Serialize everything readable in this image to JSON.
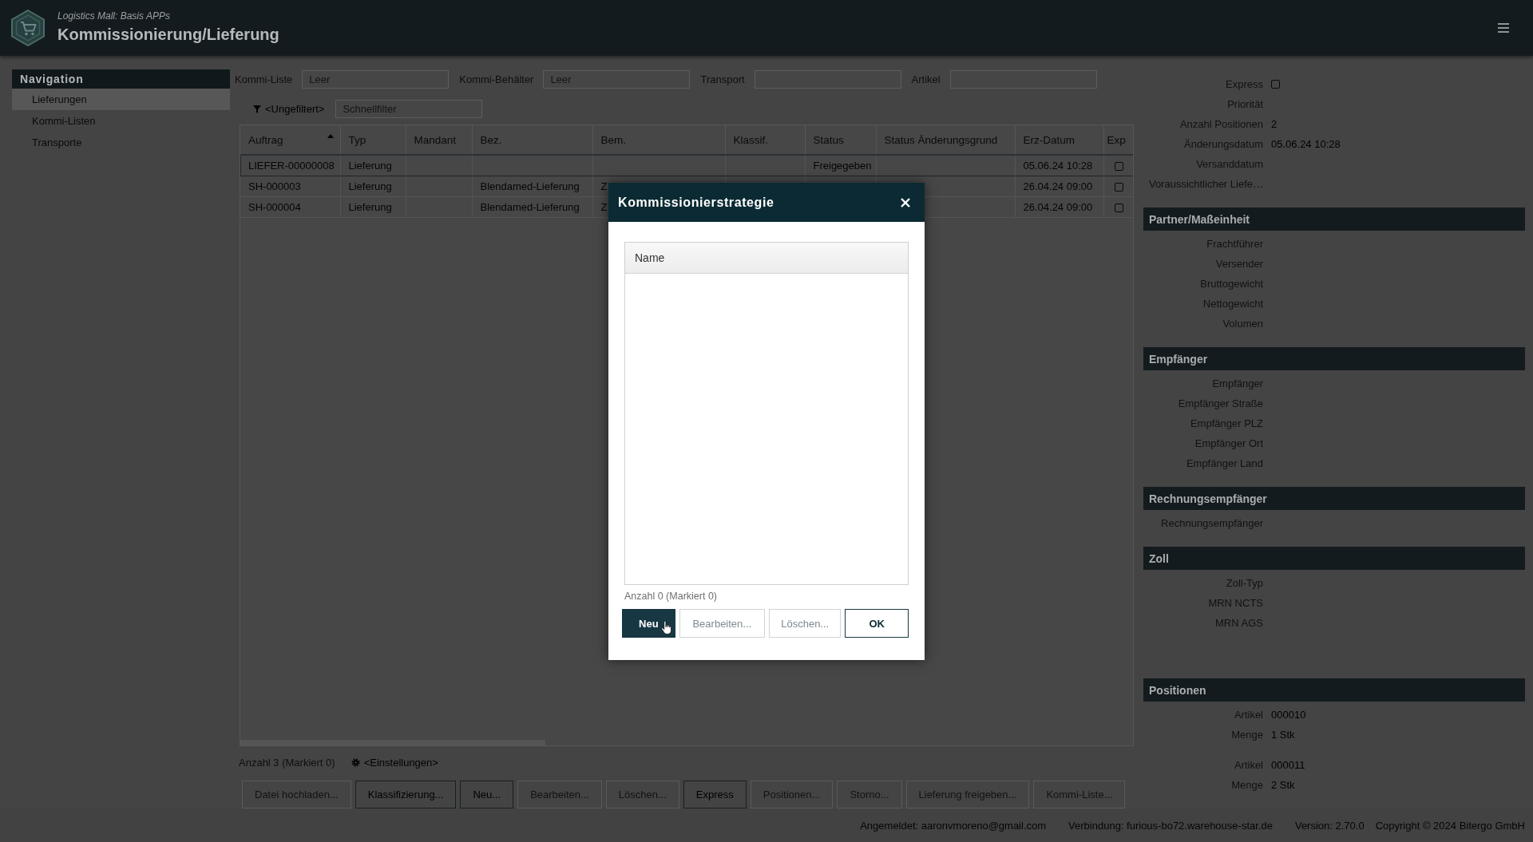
{
  "header": {
    "subtitle": "Logistics Mall: Basis APPs",
    "title": "Kommissionierung/Lieferung"
  },
  "navigation": {
    "title": "Navigation",
    "items": [
      {
        "label": "Lieferungen",
        "selected": true
      },
      {
        "label": "Kommi-Listen",
        "selected": false
      },
      {
        "label": "Transporte",
        "selected": false
      }
    ]
  },
  "filters": [
    {
      "label": "Kommi-Liste",
      "placeholder": "Leer"
    },
    {
      "label": "Kommi-Behälter",
      "placeholder": "Leer"
    },
    {
      "label": "Transport"
    },
    {
      "label": "Artikel"
    }
  ],
  "quick_filter": {
    "filter": "<Ungefiltert>",
    "placeholder": "Schnellfilter"
  },
  "table": {
    "columns": [
      {
        "label": "Auftrag",
        "kind": "text",
        "sorted": true
      },
      {
        "label": "Typ",
        "kind": "text",
        "sorted": false
      },
      {
        "label": "Mandant",
        "kind": "text",
        "sorted": false
      },
      {
        "label": "Bez.",
        "kind": "text",
        "sorted": false
      },
      {
        "label": "Bem.",
        "kind": "text",
        "sorted": false
      },
      {
        "label": "Klassif.",
        "kind": "text",
        "sorted": false
      },
      {
        "label": "Status",
        "kind": "text",
        "sorted": false
      },
      {
        "label": "Status Änderungsgrund",
        "kind": "text",
        "sorted": false
      },
      {
        "label": "Erz-Datum",
        "kind": "text",
        "sorted": false
      },
      {
        "label": "Exp",
        "kind": "checkbox",
        "sorted": false
      }
    ],
    "rows": [
      {
        "selected": true,
        "auftrag": "LIEFER-00000008",
        "typ": "Lieferung",
        "status": "Freigegeben",
        "erz_datum": "05.06.24 10:28",
        "exp": false
      },
      {
        "selected": false,
        "auftrag": "SH-000003",
        "typ": "Lieferung",
        "bez": "Blendamed-Lieferung",
        "bem": "Z",
        "erz_datum": "26.04.24 09:00",
        "exp": false
      },
      {
        "selected": false,
        "auftrag": "SH-000004",
        "typ": "Lieferung",
        "bez": "Blendamed-Lieferung",
        "bem": "Z",
        "erz_datum": "26.04.24 09:00",
        "exp": false
      }
    ]
  },
  "table_footer": {
    "count": "Anzahl 3 (Markiert 0)",
    "settings": "<Einstellungen>"
  },
  "actions": [
    {
      "label": "Datei hochladen...",
      "disabled": true
    },
    {
      "label": "Klassifizierung...",
      "disabled": false
    },
    {
      "label": "Neu...",
      "disabled": false
    },
    {
      "label": "Bearbeiten...",
      "disabled": true
    },
    {
      "label": "Löschen...",
      "disabled": true
    },
    {
      "label": "Express",
      "disabled": false
    },
    {
      "label": "Positionen...",
      "disabled": true
    },
    {
      "label": "Storno...",
      "disabled": true
    },
    {
      "label": "Lieferung freigeben...",
      "disabled": true
    },
    {
      "label": "Kommi-Liste...",
      "disabled": true
    }
  ],
  "details": {
    "fields": [
      {
        "label": "Express",
        "kind": "checkbox",
        "checked": false
      },
      {
        "label": "Priorität",
        "kind": "text"
      },
      {
        "label": "Anzahl Positionen",
        "kind": "text",
        "value": "2"
      },
      {
        "label": "Änderungsdatum",
        "kind": "text",
        "value": "05.06.24 10:28"
      },
      {
        "label": "Versanddatum",
        "kind": "text"
      },
      {
        "label": "Voraussichtlicher Liefe…",
        "kind": "text"
      }
    ],
    "sections": [
      {
        "title": "Partner/Maßeinheit",
        "kind": "fields",
        "fields": [
          {
            "label": "Frachtführer"
          },
          {
            "label": "Versender"
          },
          {
            "label": "Bruttogewicht"
          },
          {
            "label": "Nettogewicht"
          },
          {
            "label": "Volumen"
          }
        ]
      },
      {
        "title": "Empfänger",
        "kind": "fields",
        "fields": [
          {
            "label": "Empfänger"
          },
          {
            "label": "Empfänger Straße"
          },
          {
            "label": "Empfänger PLZ"
          },
          {
            "label": "Empfänger Ort"
          },
          {
            "label": "Empfänger Land"
          }
        ]
      },
      {
        "title": "Rechnungsempfänger",
        "kind": "fields",
        "fields": [
          {
            "label": "Rechnungsempfänger"
          }
        ]
      },
      {
        "title": "Zoll",
        "kind": "fields",
        "fields": [
          {
            "label": "Zoll-Typ"
          },
          {
            "label": "MRN NCTS"
          },
          {
            "label": "MRN AGS"
          }
        ]
      },
      {
        "title": "Positionen",
        "kind": "positions",
        "positions": [
          {
            "fields": [
              {
                "label": "Artikel",
                "value": "000010"
              },
              {
                "label": "Menge",
                "value": "1 Stk"
              }
            ]
          },
          {
            "fields": [
              {
                "label": "Artikel",
                "value": "000011"
              },
              {
                "label": "Menge",
                "value": "2 Stk"
              }
            ]
          }
        ]
      }
    ]
  },
  "dialog": {
    "title": "Kommissionierstrategie",
    "list": {
      "columns": [
        {
          "label": "Name"
        }
      ]
    },
    "count": "Anzahl 0 (Markiert 0)",
    "buttons": [
      {
        "label": "Neu",
        "kind": "primary",
        "disabled": false
      },
      {
        "label": "Bearbeiten...",
        "kind": "secondary",
        "disabled": true
      },
      {
        "label": "Löschen...",
        "kind": "secondary",
        "disabled": true
      },
      {
        "label": "OK",
        "kind": "secondary",
        "disabled": false
      }
    ]
  },
  "status_bar": [
    "Angemeldet: aaronvmoreno@gmail.com",
    "Verbindung: furious-bo72.warehouse-star.de",
    "Version: 2.70.0",
    "Copyright © 2024 Bitergo GmbH"
  ]
}
